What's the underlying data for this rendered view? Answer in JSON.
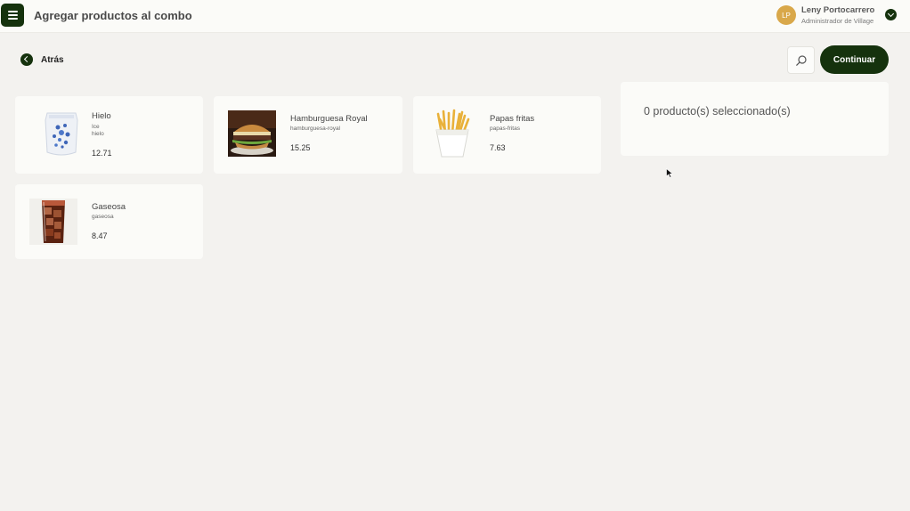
{
  "header": {
    "title": "Agregar productos al combo",
    "user": {
      "initials": "LP",
      "name": "Leny Portocarrero",
      "role": "Administrador de Village"
    }
  },
  "nav": {
    "back_label": "Atrás"
  },
  "actions": {
    "continue_label": "Continuar"
  },
  "products": [
    {
      "name": "Hielo",
      "tags": [
        "Ice",
        "hielo"
      ],
      "price": "12.71"
    },
    {
      "name": "Hamburguesa Royal",
      "tags": [
        "hamburguesa-royal"
      ],
      "price": "15.25"
    },
    {
      "name": "Papas fritas",
      "tags": [
        "papas-fritas"
      ],
      "price": "7.63"
    },
    {
      "name": "Gaseosa",
      "tags": [
        "gaseosa"
      ],
      "price": "8.47"
    }
  ],
  "selection": {
    "summary": "0 producto(s) seleccionado(s)"
  },
  "colors": {
    "primary": "#15320d",
    "accent": "#d9a84a",
    "background": "#f3f2ef",
    "card": "#fbfbf8"
  }
}
